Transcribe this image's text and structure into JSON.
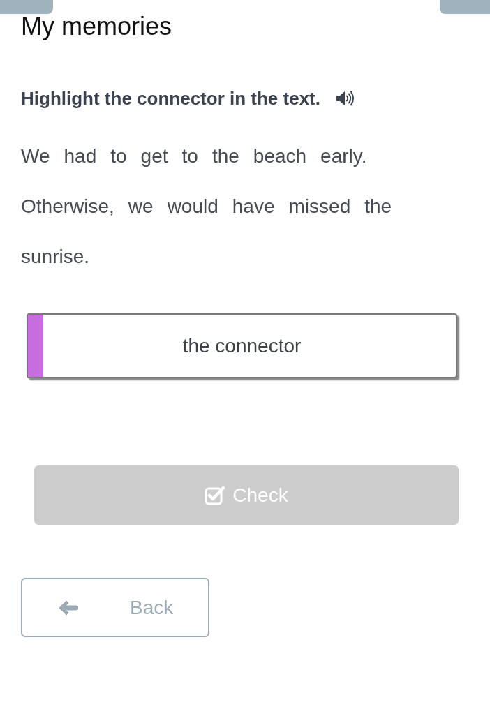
{
  "page": {
    "title": "My memories"
  },
  "task": {
    "instruction": "Highlight the connector in the text."
  },
  "text": {
    "words": [
      "We",
      "had",
      "to",
      "get",
      "to",
      "the",
      "beach",
      "early.",
      "Otherwise,",
      "we",
      "would",
      "have",
      "missed",
      "the",
      "sunrise."
    ]
  },
  "answer_slot": {
    "label": "the connector"
  },
  "buttons": [
    {
      "kind": "check",
      "label": "Check",
      "disabled": true
    },
    {
      "kind": "back",
      "label": "Back",
      "disabled": false
    }
  ]
}
